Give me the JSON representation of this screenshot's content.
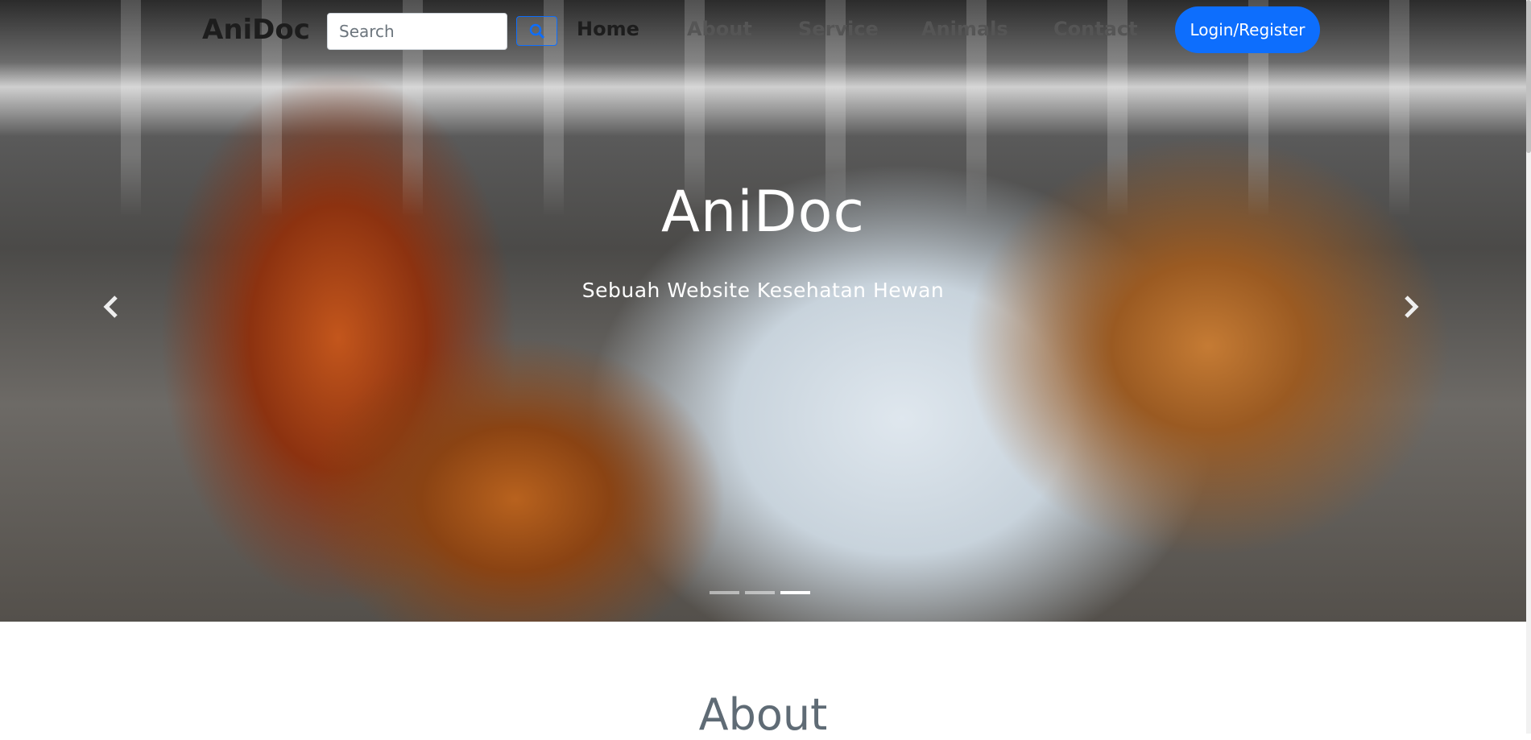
{
  "navbar": {
    "brand": "AniDoc",
    "search_placeholder": "Search",
    "search_value": "",
    "links": [
      "Home",
      "About",
      "Service",
      "Animals",
      "Contact"
    ],
    "active_link": "Home",
    "login_label": "Login/Register",
    "accent_color": "#0d6efd"
  },
  "hero": {
    "title": "AniDoc",
    "subtitle": "Sebuah Website Kesehatan Hewan",
    "prev_icon": "chevron-left-icon",
    "next_icon": "chevron-right-icon",
    "slide_count": 3,
    "active_slide": 3
  },
  "about": {
    "heading": "About"
  }
}
